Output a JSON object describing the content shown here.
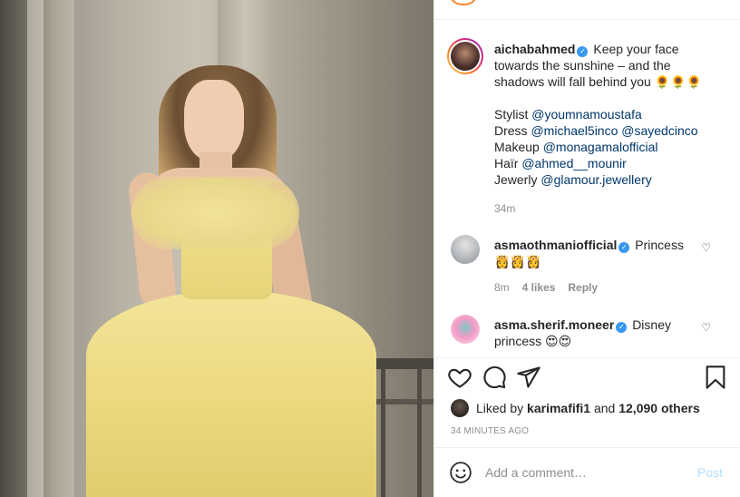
{
  "post": {
    "author": {
      "username": "aichabahmed",
      "verified": true
    },
    "caption": {
      "lead": "Keep your face towards the sunshine – and the shadows will fall behind you 🌻🌻🌻",
      "credits": [
        {
          "label": "Stylist",
          "handles": [
            "@youmnamoustafa"
          ]
        },
        {
          "label": "Dress",
          "handles": [
            "@michael5inco",
            "@sayedcinco"
          ]
        },
        {
          "label": "Makeup",
          "handles": [
            "@monagamalofficial"
          ]
        },
        {
          "label": "Haïr",
          "handles": [
            "@ahmed__mounir"
          ]
        },
        {
          "label": "Jewerly",
          "handles": [
            "@glamour.jewellery"
          ]
        }
      ],
      "time": "34m"
    },
    "comments": [
      {
        "username": "asmaothmaniofficial",
        "verified": true,
        "text": "Princess",
        "emoji": "👸👸👸",
        "time": "8m",
        "likes": "4 likes",
        "reply": "Reply"
      },
      {
        "username": "asma.sherif.moneer",
        "verified": true,
        "text": "Disney",
        "text2": "princess 😍😍"
      }
    ],
    "liked_by": {
      "prefix": "Liked by",
      "user": "karimafifi1",
      "and": "and",
      "others": "12,090 others"
    },
    "timestamp": "34 MINUTES AGO",
    "add_comment_placeholder": "Add a comment…",
    "post_label": "Post"
  },
  "icons": {
    "like": "heart-icon",
    "comment": "comment-bubble-icon",
    "share": "paper-plane-icon",
    "save": "bookmark-icon",
    "emoji": "smiley-icon"
  },
  "colors": {
    "verified": "#3897f0",
    "link": "#00376b",
    "muted": "#8e8e8e",
    "post_disabled": "#b2dffc"
  }
}
